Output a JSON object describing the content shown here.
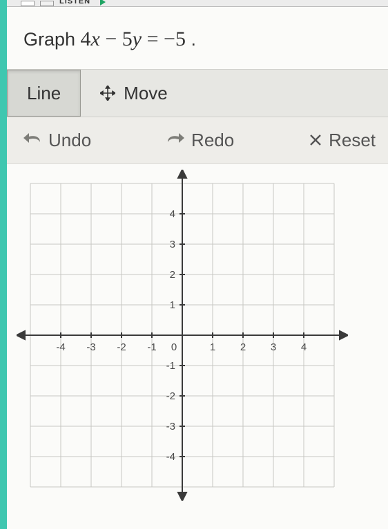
{
  "top_fragment": "LISTEN",
  "prompt": {
    "prefix": "Graph ",
    "coef1": "4",
    "var1": "x",
    "op1": " − ",
    "coef2": "5",
    "var2": "y",
    "eq": " = ",
    "rhs": "−5",
    "suffix": " ."
  },
  "tools": {
    "line": "Line",
    "move": "Move"
  },
  "actions": {
    "undo": "Undo",
    "redo": "Redo",
    "reset": "Reset"
  },
  "graph": {
    "x_ticks": [
      "-4",
      "-3",
      "-2",
      "-1",
      "1",
      "2",
      "3",
      "4"
    ],
    "y_ticks_pos": [
      "1",
      "2",
      "3",
      "4"
    ],
    "y_ticks_neg": [
      "-1",
      "-2",
      "-3",
      "-4"
    ],
    "origin_label": "0",
    "x_min": -5,
    "x_max": 5,
    "y_min": -5,
    "y_max": 5
  },
  "chart_data": {
    "type": "line",
    "title": "",
    "xlabel": "",
    "ylabel": "",
    "xlim": [
      -5,
      5
    ],
    "ylim": [
      -5,
      5
    ],
    "gridlines": true,
    "series": []
  }
}
